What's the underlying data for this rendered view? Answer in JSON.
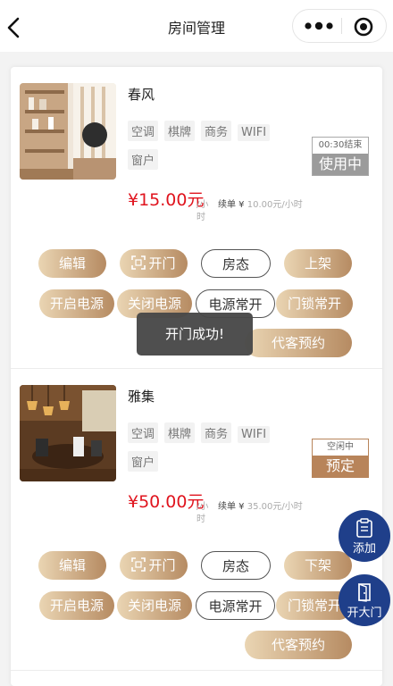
{
  "header": {
    "title": "房间管理"
  },
  "rooms": [
    {
      "name": "春风",
      "tags": [
        "空调",
        "棋牌",
        "商务",
        "WIFI",
        "窗户"
      ],
      "status_top": "00:30结束",
      "status_bottom": "使用中",
      "status_color": "#9b9b9b",
      "price": "¥15.00元",
      "unit": "/小时",
      "renew_label": "续单 ¥",
      "renew_value": "10.00元/小时",
      "buttons": {
        "edit": "编辑",
        "open": "开门",
        "room_status": "房态",
        "shelf": "上架",
        "power_on": "开启电源",
        "power_off": "关闭电源",
        "power_always": "电源常开",
        "lock_always": "门锁常开",
        "book": "代客预约"
      }
    },
    {
      "name": "雅集",
      "tags": [
        "空调",
        "棋牌",
        "商务",
        "WIFI",
        "窗户"
      ],
      "status_top": "空闲中",
      "status_bottom": "预定",
      "status_color": "#b8845a",
      "price": "¥50.00元",
      "unit": "/小时",
      "renew_label": "续单 ¥",
      "renew_value": "35.00元/小时",
      "buttons": {
        "edit": "编辑",
        "open": "开门",
        "room_status": "房态",
        "shelf": "下架",
        "power_on": "开启电源",
        "power_off": "关闭电源",
        "power_always": "电源常开",
        "lock_always": "门锁常开",
        "book": "代客预约"
      }
    }
  ],
  "toast": "开门成功!",
  "fab": {
    "add": "添加",
    "open_main_door": "开大门"
  },
  "colors": {
    "accent_gold": "#b68b62",
    "price_red": "#e0141e",
    "fab_blue": "#1f3f8a"
  }
}
